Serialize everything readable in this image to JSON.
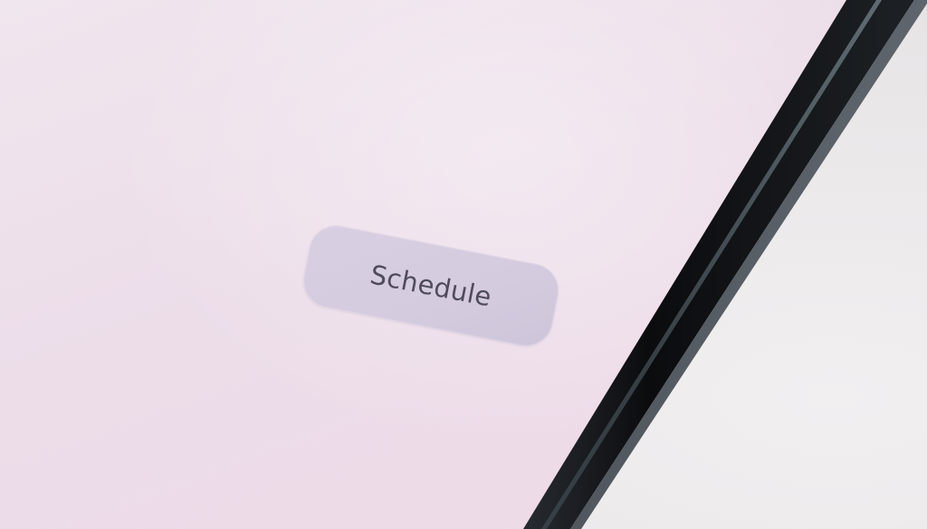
{
  "screen": {
    "background_color": "#eddfea",
    "primary_button": {
      "label": "Schedule",
      "background_color": "#d6cce0",
      "text_color": "#4f4b5c"
    }
  },
  "device": {
    "bezel_color": "#111316"
  }
}
